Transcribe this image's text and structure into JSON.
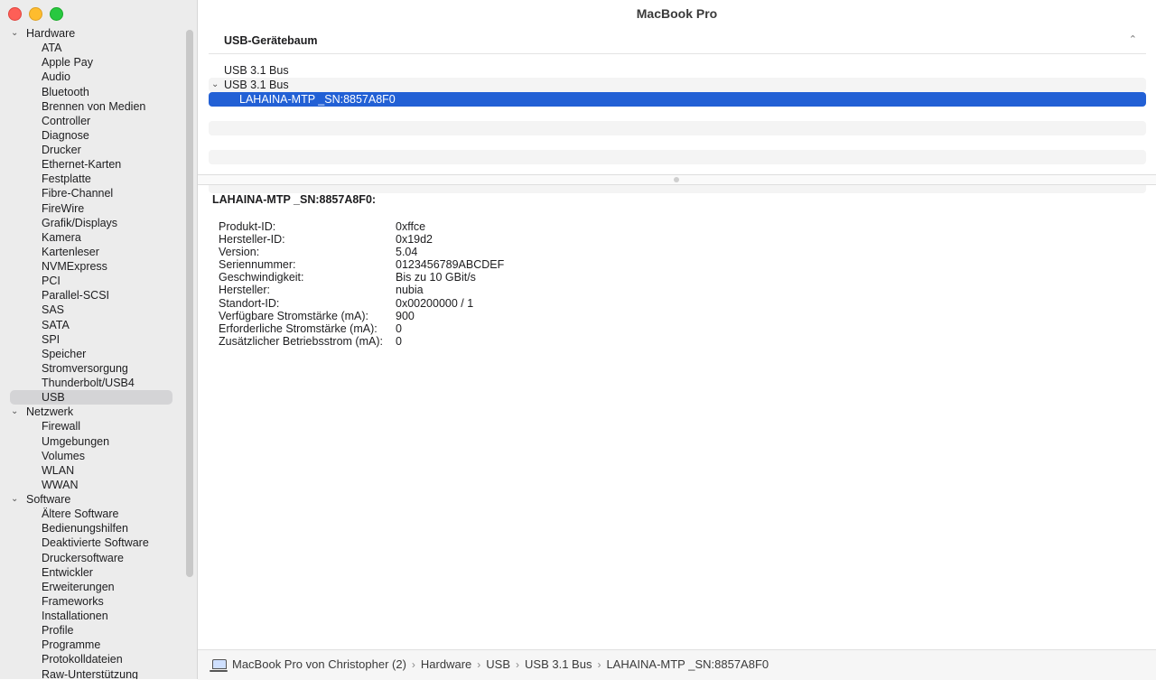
{
  "window": {
    "title": "MacBook Pro"
  },
  "sidebar": {
    "groups": [
      {
        "label": "Hardware",
        "items": [
          "ATA",
          "Apple Pay",
          "Audio",
          "Bluetooth",
          "Brennen von Medien",
          "Controller",
          "Diagnose",
          "Drucker",
          "Ethernet-Karten",
          "Festplatte",
          "Fibre-Channel",
          "FireWire",
          "Grafik/Displays",
          "Kamera",
          "Kartenleser",
          "NVMExpress",
          "PCI",
          "Parallel-SCSI",
          "SAS",
          "SATA",
          "SPI",
          "Speicher",
          "Stromversorgung",
          "Thunderbolt/USB4",
          "USB"
        ]
      },
      {
        "label": "Netzwerk",
        "items": [
          "Firewall",
          "Umgebungen",
          "Volumes",
          "WLAN",
          "WWAN"
        ]
      },
      {
        "label": "Software",
        "items": [
          "Ältere Software",
          "Bedienungshilfen",
          "Deaktivierte Software",
          "Druckersoftware",
          "Entwickler",
          "Erweiterungen",
          "Frameworks",
          "Installationen",
          "Profile",
          "Programme",
          "Protokolldateien",
          "Raw-Unterstützung"
        ]
      }
    ],
    "selected": "USB"
  },
  "tree": {
    "header": "USB-Gerätebaum",
    "rows": [
      {
        "label": "USB 3.1 Bus"
      },
      {
        "label": "USB 3.1 Bus"
      },
      {
        "label": "LAHAINA-MTP _SN:8857A8F0"
      }
    ]
  },
  "detail": {
    "title": "LAHAINA-MTP _SN:8857A8F0:",
    "props": [
      {
        "k": "Produkt-ID:",
        "v": "0xffce"
      },
      {
        "k": "Hersteller-ID:",
        "v": "0x19d2"
      },
      {
        "k": "Version:",
        "v": "5.04"
      },
      {
        "k": "Seriennummer:",
        "v": "0123456789ABCDEF"
      },
      {
        "k": "Geschwindigkeit:",
        "v": "Bis zu 10 GBit/s"
      },
      {
        "k": "Hersteller:",
        "v": "nubia"
      },
      {
        "k": "Standort-ID:",
        "v": "0x00200000 / 1"
      },
      {
        "k": "Verfügbare Stromstärke (mA):",
        "v": "900"
      },
      {
        "k": "Erforderliche Stromstärke (mA):",
        "v": "0"
      },
      {
        "k": "Zusätzlicher Betriebsstrom (mA):",
        "v": "0"
      }
    ]
  },
  "pathbar": {
    "crumbs": [
      "MacBook Pro von Christopher (2)",
      "Hardware",
      "USB",
      "USB 3.1 Bus",
      "LAHAINA-MTP _SN:8857A8F0"
    ]
  }
}
